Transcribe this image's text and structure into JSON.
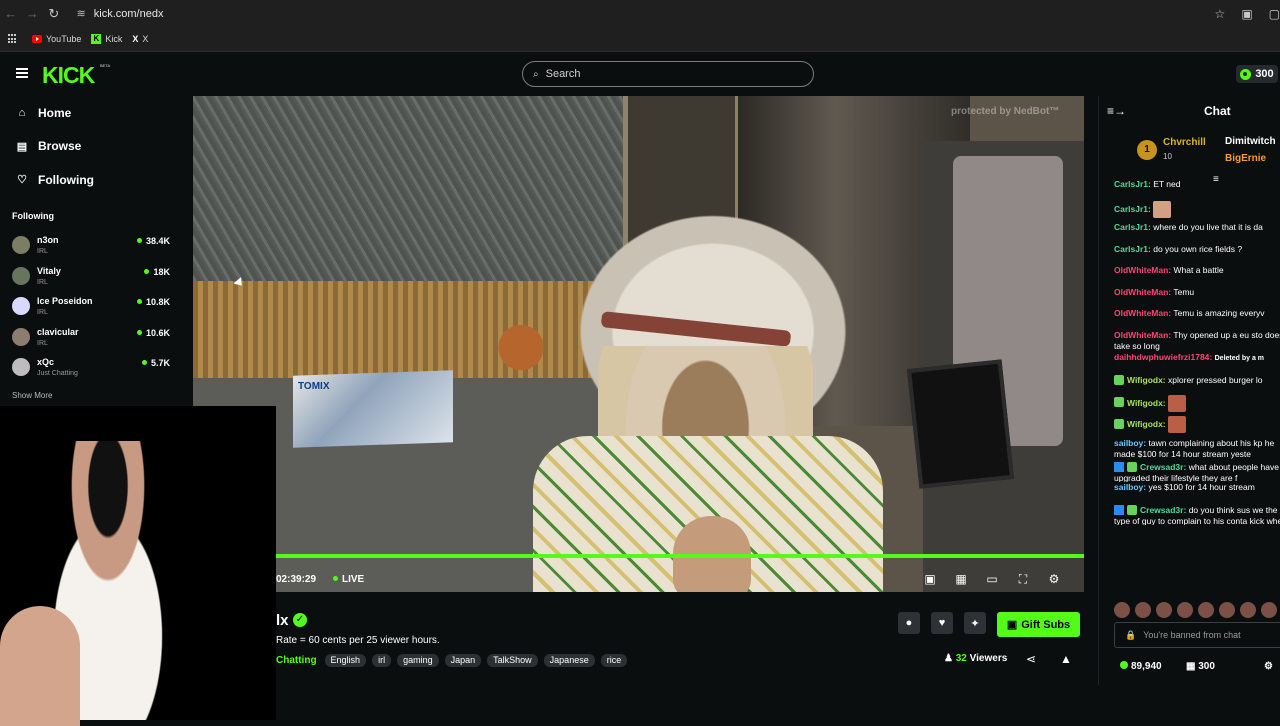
{
  "browser": {
    "url": "kick.com/nedx",
    "bookmarks": [
      "YouTube",
      "Kick",
      "X"
    ]
  },
  "header": {
    "logo": "KICK",
    "beta_label": "BETA",
    "search_placeholder": "Search",
    "coins": "300"
  },
  "sidebar": {
    "nav": [
      {
        "label": "Home",
        "icon": "home-icon"
      },
      {
        "label": "Browse",
        "icon": "browse-icon"
      },
      {
        "label": "Following",
        "icon": "heart-icon"
      }
    ],
    "section_title": "Following",
    "following": [
      {
        "name": "n3on",
        "category": "IRL",
        "viewers": "38.4K"
      },
      {
        "name": "Vitaly",
        "category": "IRL",
        "viewers": "18K"
      },
      {
        "name": "Ice Poseidon",
        "category": "IRL",
        "viewers": "10.8K"
      },
      {
        "name": "clavicular",
        "category": "IRL",
        "viewers": "10.6K"
      },
      {
        "name": "xQc",
        "category": "Just Chatting",
        "viewers": "5.7K"
      }
    ],
    "show_more": "Show More"
  },
  "video": {
    "watermark": "protected by NedBot™",
    "box_label": "TOMIX",
    "time": "02:39:29",
    "live": "LIVE",
    "progress": 1
  },
  "stream": {
    "name": "lx",
    "title": "Rate = 60 cents per 25 viewer hours.",
    "category": "Chatting",
    "tags": [
      "English",
      "irl",
      "gaming",
      "Japan",
      "TalkShow",
      "Japanese",
      "rice"
    ],
    "viewers_count": "32",
    "viewers_label": "Viewers",
    "gift_label": "Gift Subs"
  },
  "chat": {
    "title": "Chat",
    "leaderboard": {
      "rank": "1",
      "first": "Chvrchill",
      "first_count": "10",
      "second": "Dimitwitch",
      "third": "BigErnie"
    },
    "messages": [
      {
        "user": "CarlsJr1:",
        "text": "ET ned"
      },
      {
        "user": "CarlsJr1:",
        "text": ""
      },
      {
        "user": "CarlsJr1:",
        "text": "where do you live that it is da"
      },
      {
        "user": "CarlsJr1:",
        "text": "do you own rice fields ?"
      },
      {
        "user": "OldWhiteMan:",
        "text": "What a battle"
      },
      {
        "user": "OldWhiteMan:",
        "text": "Temu"
      },
      {
        "user": "OldWhiteMan:",
        "text": "Temu is amazing everyv"
      },
      {
        "user": "OldWhiteMan:",
        "text": "Thy opened up a eu sto doesnt take so long"
      },
      {
        "user": "daihhdwphuwiefrzi1784:",
        "text": "Deleted by a m"
      },
      {
        "user": "Wifigodx:",
        "text": "xplorer pressed burger lo"
      },
      {
        "user": "Wifigodx:",
        "text": ""
      },
      {
        "user": "Wifigodx:",
        "text": ""
      },
      {
        "user": "sailboy:",
        "text": "tawn complaining about his kp he made $100 for 14 hour stream yeste"
      },
      {
        "user": "Crewsad3r:",
        "text": "what about people have upgraded their lifestyle they are f"
      },
      {
        "user": "sailboy:",
        "text": "yes $100 for 14 hour stream"
      },
      {
        "user": "Crewsad3r:",
        "text": "do you think sus we the type of guy to complain to his conta kick when his rate drops?"
      }
    ],
    "banned_text": "You're banned from chat",
    "points": "89,940",
    "balance": "300"
  }
}
